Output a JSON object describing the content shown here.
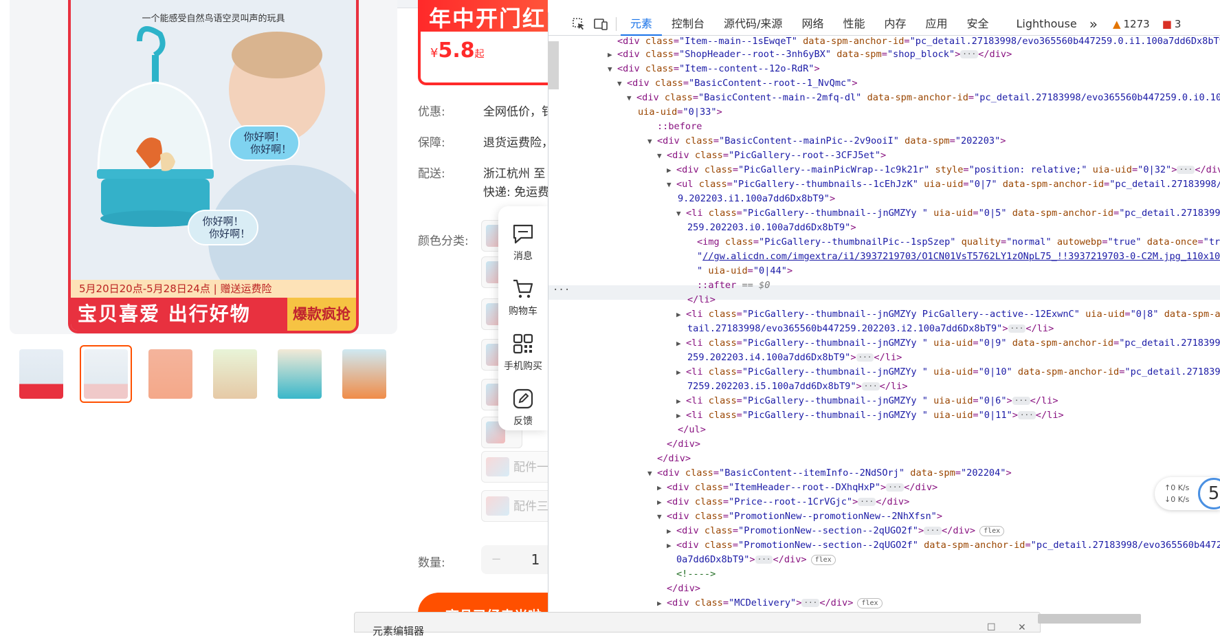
{
  "product": {
    "image_caption": "一个能感受自然鸟语空灵叫声的玩具",
    "bubble_top": "你好啊！\n    你好啊！",
    "bubble_bottom": "你好啊！\n    你好啊！",
    "date_bar": "5月20日20点-5月28日24点 | 赠送运费险",
    "slogan": "宝贝喜爱 出行好物",
    "slogan_tag": "爆款疯抢",
    "price_banner": "年中开门红",
    "price_symbol": "¥",
    "price_value": "5.8",
    "price_suffix": "起",
    "rows": [
      {
        "label": "优惠:",
        "value": "全网低价，钅"
      },
      {
        "label": "保障:",
        "value": "退货运费险，"
      },
      {
        "label": "配送:",
        "value": "浙江杭州  至"
      },
      {
        "label": "",
        "value": "快递: 免运费"
      },
      {
        "label": "颜色分类:",
        "value": ""
      }
    ],
    "sku_wide": [
      {
        "label": "配件一"
      },
      {
        "label": "配件三"
      }
    ],
    "qty_label": "数量:",
    "qty_minus": "−",
    "qty_value": "1",
    "buy_button": "商品已经卖光啦"
  },
  "side_toolbar": [
    {
      "label": "消息",
      "icon": "message-icon"
    },
    {
      "label": "购物车",
      "icon": "cart-icon"
    },
    {
      "label": "手机购买",
      "icon": "qrcode-icon"
    },
    {
      "label": "反馈",
      "icon": "feedback-icon"
    }
  ],
  "devtools": {
    "tabs": [
      "元素",
      "控制台",
      "源代码/来源",
      "网络",
      "性能",
      "内存",
      "应用",
      "安全",
      "Lighthouse"
    ],
    "active_tab": "元素",
    "more": "»",
    "warnings": "1273",
    "errors": "3",
    "selected_line_marker": "== $0"
  },
  "network_widget": {
    "up": "↑0  K/s",
    "down": "↓0  K/s",
    "badge": "5"
  },
  "bottom_window": {
    "title": "元素编辑器"
  },
  "colors": {
    "accent_red": "#e8313f",
    "taobao_orange": "#ff5000",
    "devtools_blue": "#1a73e8",
    "tag_purple": "#881280",
    "attr_brown": "#994500",
    "attr_value_blue": "#1a1aa6"
  }
}
